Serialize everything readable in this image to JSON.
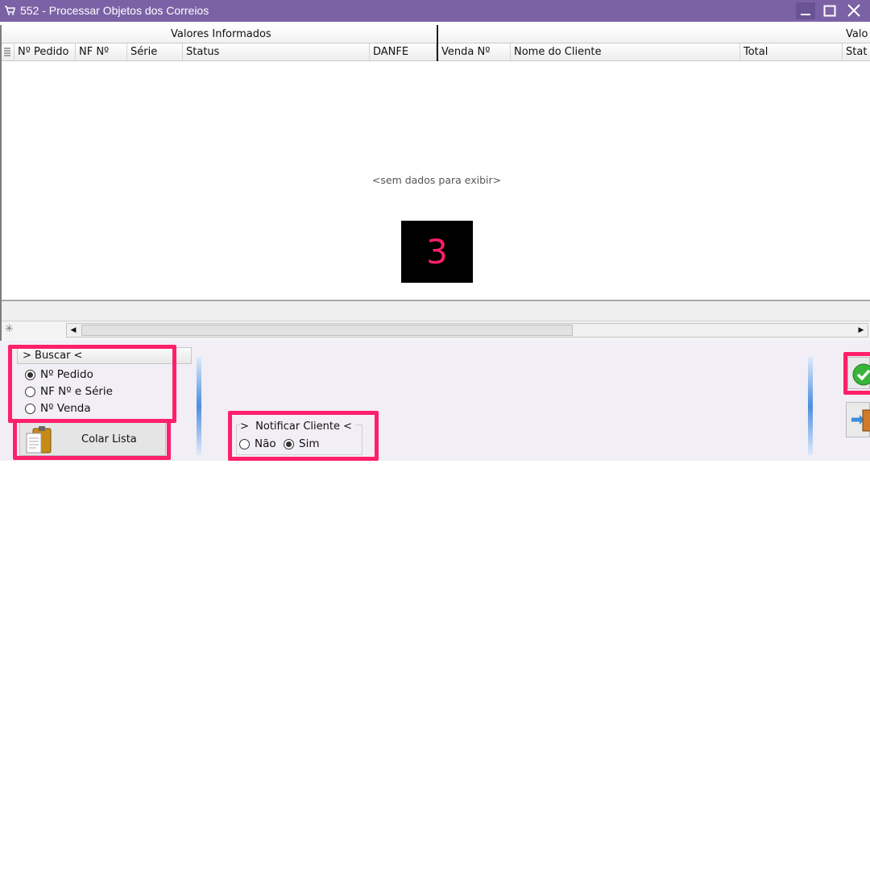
{
  "window": {
    "title": "552 - Processar Objetos dos Correios",
    "buttons": [
      "minimize",
      "maximize",
      "close"
    ]
  },
  "grid": {
    "bands": [
      "Valores Informados",
      "Valo"
    ],
    "columns": [
      "Nº Pedido",
      "NF Nº",
      "Série",
      "Status",
      "DANFE",
      "Venda Nº",
      "Nome do Cliente",
      "Total",
      "Stat"
    ],
    "empty_message": "<sem dados para exibir>",
    "new_row_icon": "asterisk-icon"
  },
  "overlay_number": "3",
  "buscar": {
    "title": "> Buscar <",
    "options": [
      "Nº Pedido",
      "NF Nº e Série",
      "Nº Venda"
    ],
    "selected": "Nº Pedido"
  },
  "paste_button": {
    "label": "Colar Lista",
    "icon": "clipboard-icon"
  },
  "notificar": {
    "title": ">  Notificar Cliente <",
    "options": [
      "Não",
      "Sim"
    ],
    "selected": "Sim"
  },
  "actions": {
    "confirm_icon": "check-icon",
    "exit_icon": "exit-door-icon"
  },
  "colors": {
    "titlebar": "#7b62a6",
    "highlight": "#ff1f6a",
    "panel": "#f2eef5"
  }
}
